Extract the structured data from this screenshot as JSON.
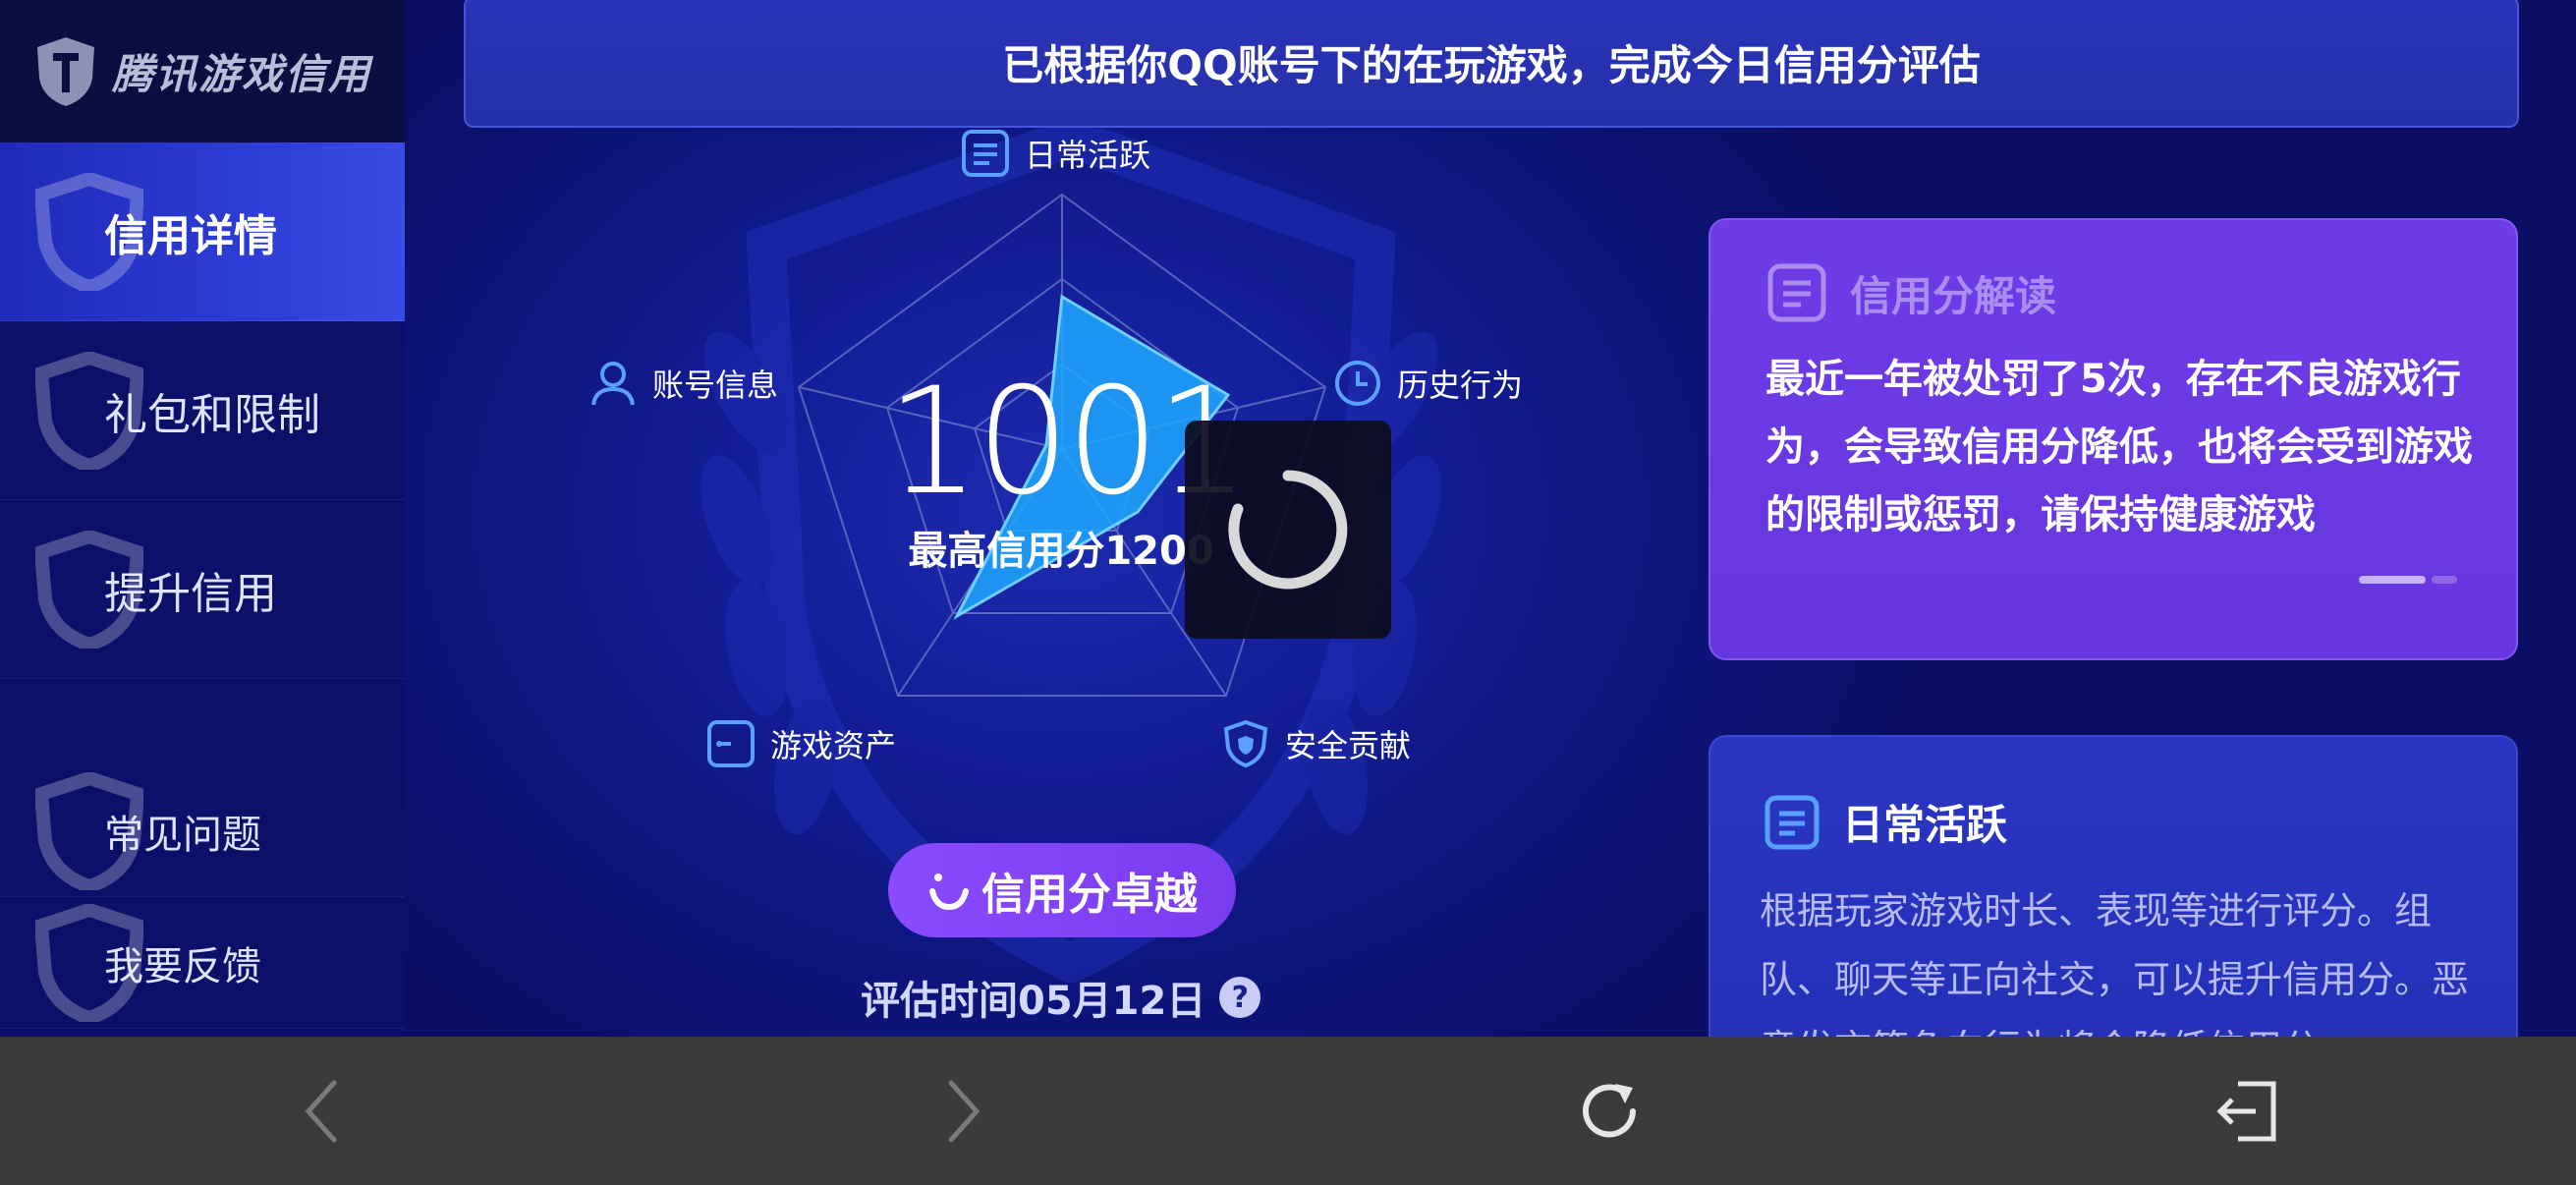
{
  "brand": {
    "name": "腾讯游戏信用"
  },
  "sidebar": {
    "items": [
      {
        "label": "信用详情",
        "active": true
      },
      {
        "label": "礼包和限制",
        "active": false
      },
      {
        "label": "提升信用",
        "active": false
      },
      {
        "label": "常见问题",
        "active": false
      },
      {
        "label": "我要反馈",
        "active": false
      }
    ]
  },
  "banner": {
    "text": "已根据你QQ账号下的在玩游戏，完成今日信用分评估"
  },
  "radar": {
    "axes": [
      {
        "label": "日常活跃",
        "icon": "document-icon"
      },
      {
        "label": "历史行为",
        "icon": "clock-icon"
      },
      {
        "label": "安全贡献",
        "icon": "shield-icon"
      },
      {
        "label": "游戏资产",
        "icon": "wallet-icon"
      },
      {
        "label": "账号信息",
        "icon": "user-icon"
      }
    ],
    "score": "1001",
    "max_label": "最高信用分1200"
  },
  "cta": {
    "label": "信用分卓越"
  },
  "eval": {
    "time": "评估时间05月12日",
    "help": "?"
  },
  "interpret_card": {
    "title": "信用分解读",
    "body": "最近一年被处罚了5次，存在不良游戏行为，会导致信用分降低，也将会受到游戏的限制或惩罚，请保持健康游戏"
  },
  "activity_card": {
    "title": "日常活跃",
    "body": "根据玩家游戏时长、表现等进行评分。组队、聊天等正向社交，可以提升信用分。恶意发言等负向行为将会降低信用分。"
  },
  "bottom_bar": {
    "buttons": [
      {
        "name": "back-icon"
      },
      {
        "name": "forward-icon"
      },
      {
        "name": "refresh-icon"
      },
      {
        "name": "exit-icon"
      }
    ]
  },
  "colors": {
    "accent_purple": "#7a3cf0",
    "radar_fill": "#1ea8ff",
    "sidebar_active": "#2f3fd8"
  }
}
